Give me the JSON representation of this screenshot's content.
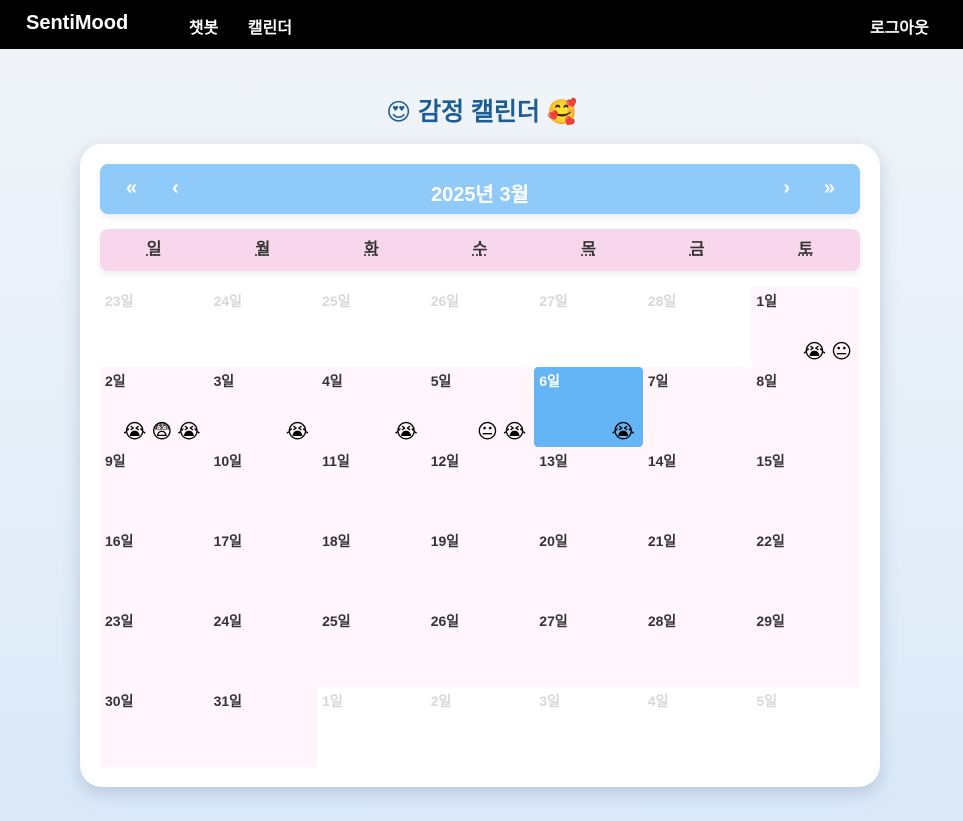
{
  "nav": {
    "brand": "SentiMood",
    "links": [
      {
        "label": "챗봇"
      },
      {
        "label": "캘린더"
      }
    ],
    "logout": "로그아웃"
  },
  "title": {
    "left_emoji": "😍",
    "text": "감정 캘린더",
    "right_emoji": "🥰"
  },
  "calendar": {
    "nav_prev_year": "«",
    "nav_prev_month": "‹",
    "nav_next_month": "›",
    "nav_next_year": "»",
    "month_label": "2025년 3월",
    "weekdays": [
      "일",
      "월",
      "화",
      "수",
      "목",
      "금",
      "토"
    ],
    "weeks": [
      [
        {
          "label": "23일",
          "neighbor": true,
          "emojis": []
        },
        {
          "label": "24일",
          "neighbor": true,
          "emojis": []
        },
        {
          "label": "25일",
          "neighbor": true,
          "emojis": []
        },
        {
          "label": "26일",
          "neighbor": true,
          "emojis": []
        },
        {
          "label": "27일",
          "neighbor": true,
          "emojis": []
        },
        {
          "label": "28일",
          "neighbor": true,
          "emojis": []
        },
        {
          "label": "1일",
          "emojis": [
            "😭",
            "😐"
          ]
        }
      ],
      [
        {
          "label": "2일",
          "emojis": [
            "😭",
            "😨",
            "😭"
          ]
        },
        {
          "label": "3일",
          "emojis": [
            "😭"
          ]
        },
        {
          "label": "4일",
          "emojis": [
            "😭"
          ]
        },
        {
          "label": "5일",
          "emojis": [
            "😐",
            "😭"
          ]
        },
        {
          "label": "6일",
          "today": true,
          "emojis": [
            "😭"
          ]
        },
        {
          "label": "7일",
          "emojis": []
        },
        {
          "label": "8일",
          "emojis": []
        }
      ],
      [
        {
          "label": "9일",
          "emojis": []
        },
        {
          "label": "10일",
          "emojis": []
        },
        {
          "label": "11일",
          "emojis": []
        },
        {
          "label": "12일",
          "emojis": []
        },
        {
          "label": "13일",
          "emojis": []
        },
        {
          "label": "14일",
          "emojis": []
        },
        {
          "label": "15일",
          "emojis": []
        }
      ],
      [
        {
          "label": "16일",
          "emojis": []
        },
        {
          "label": "17일",
          "emojis": []
        },
        {
          "label": "18일",
          "emojis": []
        },
        {
          "label": "19일",
          "emojis": []
        },
        {
          "label": "20일",
          "emojis": []
        },
        {
          "label": "21일",
          "emojis": []
        },
        {
          "label": "22일",
          "emojis": []
        }
      ],
      [
        {
          "label": "23일",
          "emojis": []
        },
        {
          "label": "24일",
          "emojis": []
        },
        {
          "label": "25일",
          "emojis": []
        },
        {
          "label": "26일",
          "emojis": []
        },
        {
          "label": "27일",
          "emojis": []
        },
        {
          "label": "28일",
          "emojis": []
        },
        {
          "label": "29일",
          "emojis": []
        }
      ],
      [
        {
          "label": "30일",
          "emojis": []
        },
        {
          "label": "31일",
          "emojis": []
        },
        {
          "label": "1일",
          "neighbor": true,
          "emojis": []
        },
        {
          "label": "2일",
          "neighbor": true,
          "emojis": []
        },
        {
          "label": "3일",
          "neighbor": true,
          "emojis": []
        },
        {
          "label": "4일",
          "neighbor": true,
          "emojis": []
        },
        {
          "label": "5일",
          "neighbor": true,
          "emojis": []
        }
      ]
    ]
  }
}
